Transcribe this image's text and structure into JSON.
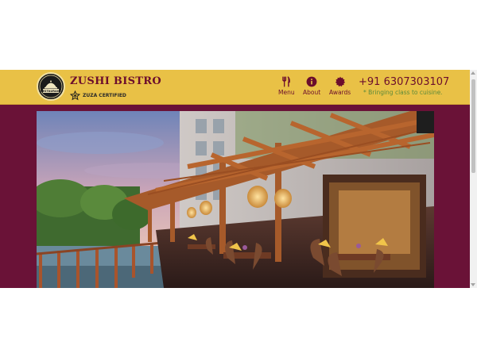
{
  "brand": {
    "name": "ZUSHI BISTRO",
    "logo_text": "RESTAURANT",
    "certification": "ZUZA CERTIFIED"
  },
  "nav": {
    "items": [
      {
        "label": "Menu",
        "icon": "fork-knife-icon"
      },
      {
        "label": "About",
        "icon": "info-icon"
      },
      {
        "label": "Awards",
        "icon": "award-badge-icon"
      }
    ]
  },
  "contact": {
    "phone": "+91 6307303107",
    "tagline": "* Bringing class to cuisine."
  },
  "hero": {
    "image": "restaurant-patio-photo"
  },
  "colors": {
    "header_bg": "#e9c146",
    "brand_maroon": "#6a1237",
    "accent_green": "#5c8a3a"
  }
}
